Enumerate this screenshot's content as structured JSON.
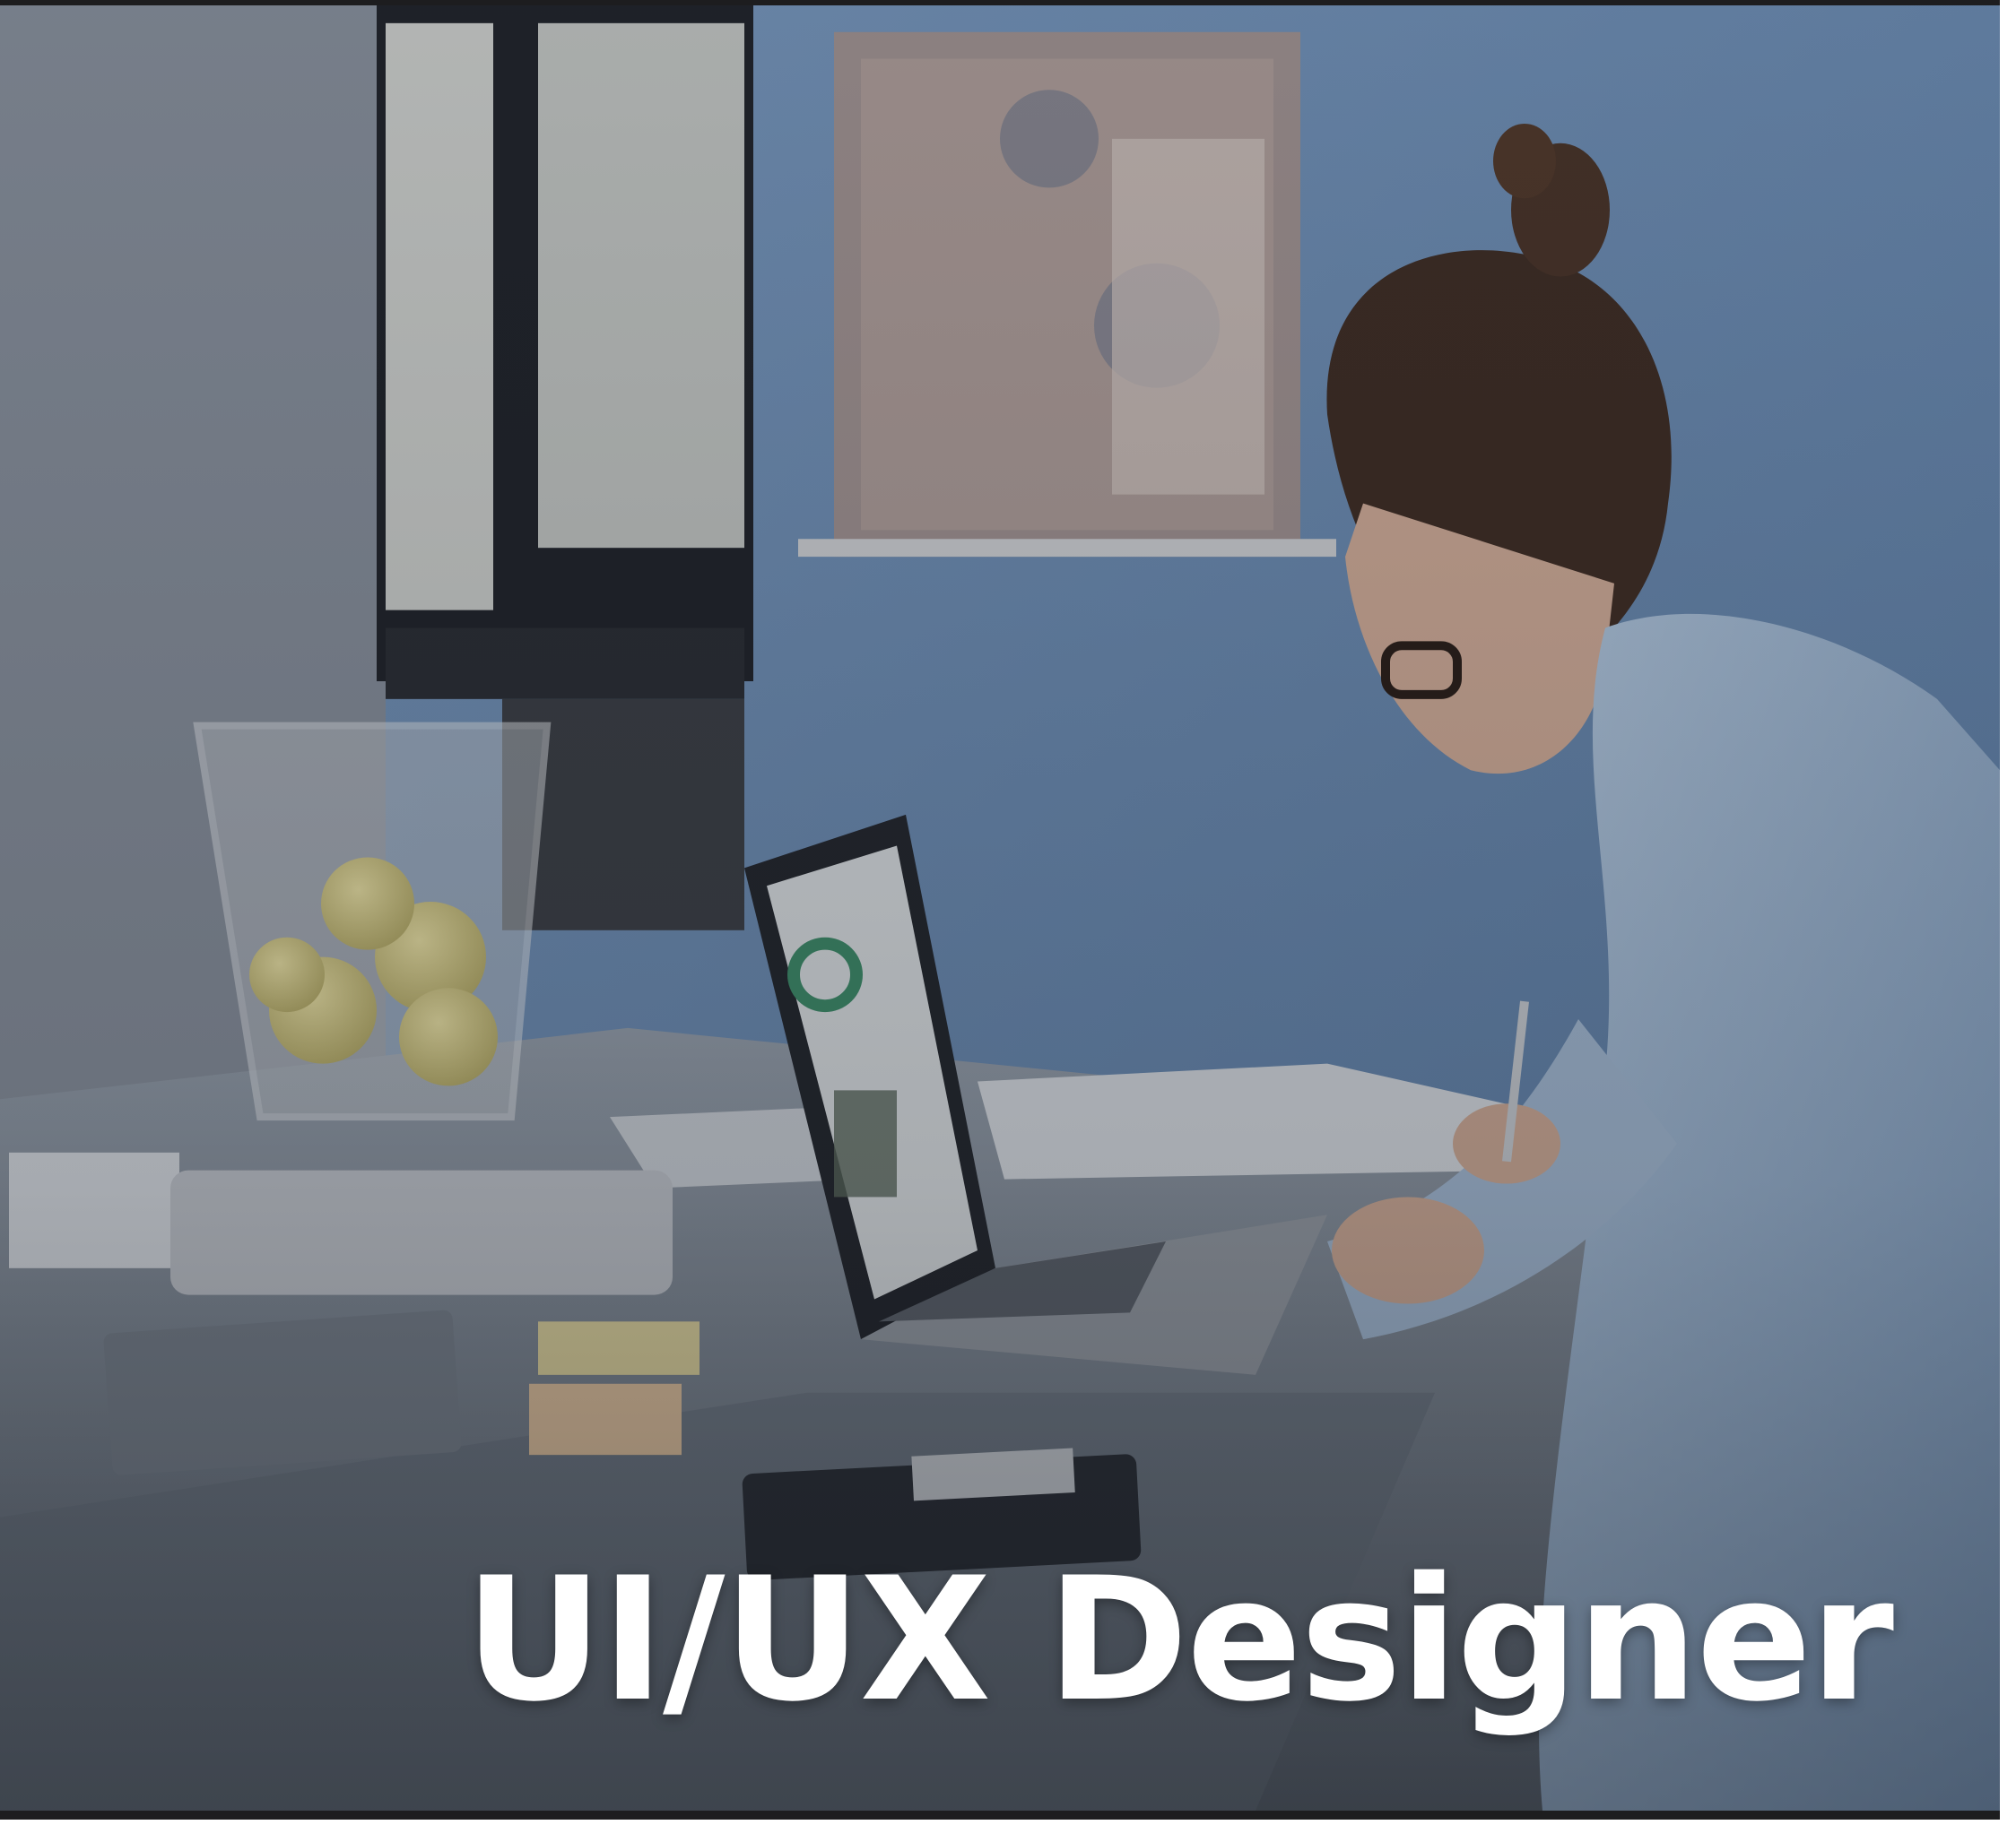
{
  "card": {
    "title": "UI/UX Designer",
    "image_subject": "woman-working-at-desk-with-laptop",
    "title_color": "#ffffff"
  }
}
